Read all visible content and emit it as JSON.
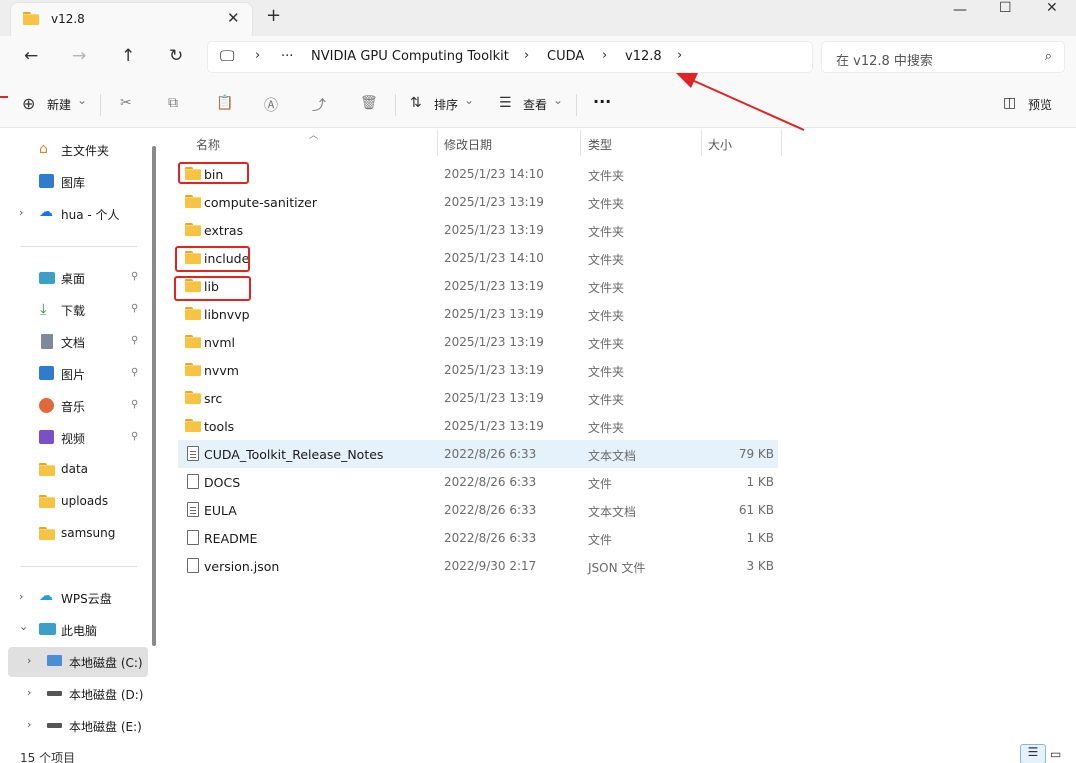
{
  "tab": {
    "title": "v12.8",
    "close": "✕",
    "new": "+"
  },
  "window": {
    "minimize": "—",
    "maximize": "☐",
    "close": "✕"
  },
  "nav": {
    "back": "←",
    "forward": "→",
    "up": "↑",
    "refresh": "↻"
  },
  "address": {
    "pc_icon": "🖵",
    "more": "···",
    "crumbs": [
      "NVIDIA GPU Computing Toolkit",
      "CUDA",
      "v12.8"
    ],
    "sep": "›"
  },
  "search": {
    "placeholder": "在 v12.8 中搜索",
    "icon": "⌕"
  },
  "toolbar": {
    "new_label": "新建",
    "sort_label": "排序",
    "view_label": "查看",
    "more": "···",
    "preview_label": "预览",
    "caret": "⌄"
  },
  "sidebar": {
    "home": "主文件夹",
    "gallery": "图库",
    "cloud": "hua - 个人",
    "desktop": "桌面",
    "downloads": "下载",
    "documents": "文档",
    "pictures": "图片",
    "music": "音乐",
    "videos": "视频",
    "data": "data",
    "uploads": "uploads",
    "samsung": "samsung",
    "wps": "WPS云盘",
    "thispc": "此电脑",
    "disk_c": "本地磁盘 (C:)",
    "disk_d": "本地磁盘 (D:)",
    "disk_e": "本地磁盘 (E:)",
    "chev_right": "›",
    "chev_down": "⌄",
    "pin": "📌"
  },
  "columns": {
    "name": "名称",
    "date": "修改日期",
    "type": "类型",
    "size": "大小"
  },
  "files": [
    {
      "name": "bin",
      "date": "2025/1/23 14:10",
      "type": "文件夹",
      "size": "",
      "kind": "folder"
    },
    {
      "name": "compute-sanitizer",
      "date": "2025/1/23 13:19",
      "type": "文件夹",
      "size": "",
      "kind": "folder"
    },
    {
      "name": "extras",
      "date": "2025/1/23 13:19",
      "type": "文件夹",
      "size": "",
      "kind": "folder"
    },
    {
      "name": "include",
      "date": "2025/1/23 14:10",
      "type": "文件夹",
      "size": "",
      "kind": "folder"
    },
    {
      "name": "lib",
      "date": "2025/1/23 13:19",
      "type": "文件夹",
      "size": "",
      "kind": "folder"
    },
    {
      "name": "libnvvp",
      "date": "2025/1/23 13:19",
      "type": "文件夹",
      "size": "",
      "kind": "folder"
    },
    {
      "name": "nvml",
      "date": "2025/1/23 13:19",
      "type": "文件夹",
      "size": "",
      "kind": "folder"
    },
    {
      "name": "nvvm",
      "date": "2025/1/23 13:19",
      "type": "文件夹",
      "size": "",
      "kind": "folder"
    },
    {
      "name": "src",
      "date": "2025/1/23 13:19",
      "type": "文件夹",
      "size": "",
      "kind": "folder"
    },
    {
      "name": "tools",
      "date": "2025/1/23 13:19",
      "type": "文件夹",
      "size": "",
      "kind": "folder"
    },
    {
      "name": "CUDA_Toolkit_Release_Notes",
      "date": "2022/8/26 6:33",
      "type": "文本文档",
      "size": "79 KB",
      "kind": "txt"
    },
    {
      "name": "DOCS",
      "date": "2022/8/26 6:33",
      "type": "文件",
      "size": "1 KB",
      "kind": "file"
    },
    {
      "name": "EULA",
      "date": "2022/8/26 6:33",
      "type": "文本文档",
      "size": "61 KB",
      "kind": "txt"
    },
    {
      "name": "README",
      "date": "2022/8/26 6:33",
      "type": "文件",
      "size": "1 KB",
      "kind": "file"
    },
    {
      "name": "version.json",
      "date": "2022/9/30 2:17",
      "type": "JSON 文件",
      "size": "3 KB",
      "kind": "file"
    }
  ],
  "status": {
    "count": "15 个项目"
  },
  "colors": {
    "accent": "#0067c0",
    "annotation_red": "#e02424",
    "folder": "#f6c342"
  }
}
